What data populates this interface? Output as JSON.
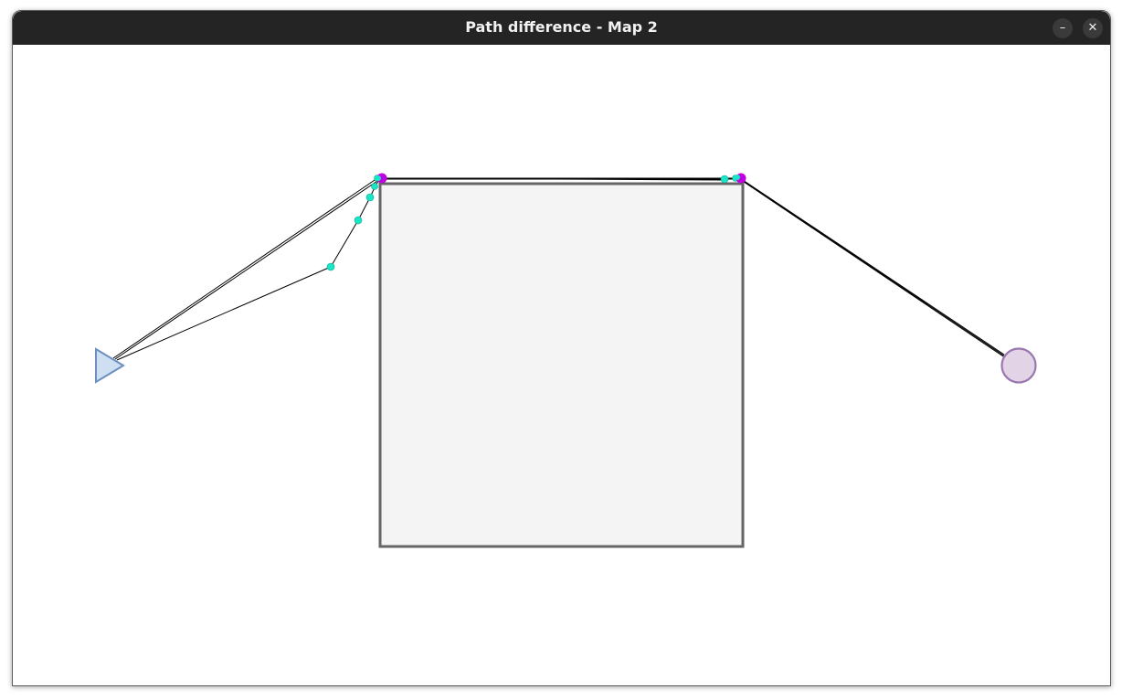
{
  "window": {
    "title": "Path difference - Map 2",
    "minimize_glyph": "–",
    "close_glyph": "✕"
  },
  "icons": {
    "minimize": "minimize-icon",
    "close": "close-icon"
  },
  "colors": {
    "titlebar": "#242424",
    "canvas": "#ffffff",
    "obstacle_fill": "#f4f4f4",
    "obstacle_stroke": "#666666",
    "start_fill": "#cfdff2",
    "start_stroke": "#6d8fc0",
    "goal_fill": "#e2d3e6",
    "goal_stroke": "#9a77ae",
    "path": "#000000",
    "waypoint": "#19e6c6",
    "corner_node": "#c000e0"
  },
  "map": {
    "start_marker": "triangle",
    "goal_marker": "circle",
    "obstacle": "square"
  }
}
